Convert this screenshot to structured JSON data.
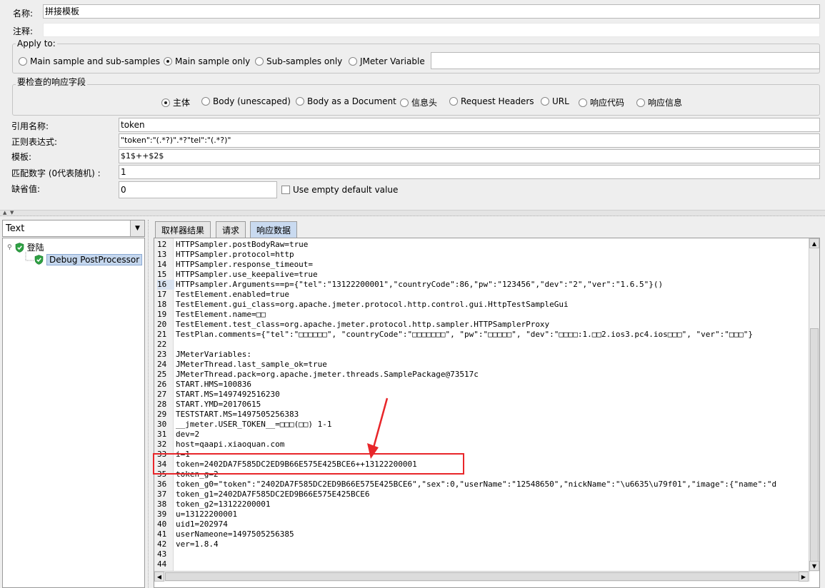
{
  "config": {
    "name_label": "名称:",
    "name_value": "拼接模板",
    "comment_label": "注释:",
    "apply_to": {
      "legend": "Apply to:",
      "options": [
        "Main sample and sub-samples",
        "Main sample only",
        "Sub-samples only",
        "JMeter Variable"
      ],
      "selected_index": 1
    },
    "field_to_check": {
      "legend": "要检查的响应字段",
      "options": [
        "主体",
        "Body (unescaped)",
        "Body as a Document",
        "信息头",
        "Request Headers",
        "URL",
        "响应代码",
        "响应信息"
      ],
      "selected_index": 0
    },
    "ref_name_label": "引用名称:",
    "ref_name_value": "token",
    "regex_label": "正则表达式:",
    "regex_value": "\"token\":\"(.*?)\".*?\"tel\":\"(.*?)\"",
    "template_label": "模板:",
    "template_value": "$1$++$2$",
    "match_no_label": "匹配数字 (0代表随机) :",
    "match_no_value": "1",
    "default_label": "缺省值:",
    "default_value": "0",
    "use_empty_label": "Use empty default value"
  },
  "results": {
    "renderer": "Text",
    "tree": {
      "root": "登陆",
      "child": "Debug PostProcessor"
    },
    "tabs": [
      "取样器结果",
      "请求",
      "响应数据"
    ],
    "active_tab": 2,
    "lines": [
      {
        "n": "12",
        "t": "HTTPSampler.postBodyRaw=true"
      },
      {
        "n": "13",
        "t": "HTTPSampler.protocol=http"
      },
      {
        "n": "14",
        "t": "HTTPSampler.response_timeout="
      },
      {
        "n": "15",
        "t": "HTTPSampler.use_keepalive=true"
      },
      {
        "n": "16",
        "t": "HTTPsampler.Arguments==p={\"tel\":\"13122200001\",\"countryCode\":86,\"pw\":\"123456\",\"dev\":\"2\",\"ver\":\"1.6.5\"}()"
      },
      {
        "n": "17",
        "t": "TestElement.enabled=true"
      },
      {
        "n": "18",
        "t": "TestElement.gui_class=org.apache.jmeter.protocol.http.control.gui.HttpTestSampleGui"
      },
      {
        "n": "19",
        "t": "TestElement.name=□□"
      },
      {
        "n": "20",
        "t": "TestElement.test_class=org.apache.jmeter.protocol.http.sampler.HTTPSamplerProxy"
      },
      {
        "n": "21",
        "t": "TestPlan.comments={\"tel\":\"□□□□□□\", \"countryCode\":\"□□□□□□□\", \"pw\":\"□□□□□\", \"dev\":\"□□□□:1.□□2.ios3.pc4.ios□□□\", \"ver\":\"□□□\"}"
      },
      {
        "n": "22",
        "t": ""
      },
      {
        "n": "23",
        "t": "JMeterVariables:"
      },
      {
        "n": "24",
        "t": "JMeterThread.last_sample_ok=true"
      },
      {
        "n": "25",
        "t": "JMeterThread.pack=org.apache.jmeter.threads.SamplePackage@73517c"
      },
      {
        "n": "26",
        "t": "START.HMS=100836"
      },
      {
        "n": "27",
        "t": "START.MS=1497492516230"
      },
      {
        "n": "28",
        "t": "START.YMD=20170615"
      },
      {
        "n": "29",
        "t": "TESTSTART.MS=1497505256383"
      },
      {
        "n": "30",
        "t": "__jmeter.USER_TOKEN__=□□□(□□) 1-1"
      },
      {
        "n": "31",
        "t": "dev=2"
      },
      {
        "n": "32",
        "t": "host=qaapi.xiaoquan.com"
      },
      {
        "n": "33",
        "t": "i=1"
      },
      {
        "n": "34",
        "t": "token=2402DA7F585DC2ED9B66E575E425BCE6++13122200001"
      },
      {
        "n": "35",
        "t": "token_g=2"
      },
      {
        "n": "36",
        "t": "token_g0=\"token\":\"2402DA7F585DC2ED9B66E575E425BCE6\",\"sex\":0,\"userName\":\"12548650\",\"nickName\":\"\\u6635\\u79f01\",\"image\":{\"name\":\"d"
      },
      {
        "n": "37",
        "t": "token_g1=2402DA7F585DC2ED9B66E575E425BCE6"
      },
      {
        "n": "38",
        "t": "token_g2=13122200001"
      },
      {
        "n": "39",
        "t": "u=13122200001"
      },
      {
        "n": "40",
        "t": "uid1=202974"
      },
      {
        "n": "41",
        "t": "userNameone=1497505256385"
      },
      {
        "n": "42",
        "t": "ver=1.8.4"
      },
      {
        "n": "43",
        "t": ""
      },
      {
        "n": "44",
        "t": ""
      }
    ]
  },
  "colors": {
    "annotation_red": "#e8262a",
    "selected_tab": "#c9daf0",
    "shield_green": "#2ea043"
  }
}
